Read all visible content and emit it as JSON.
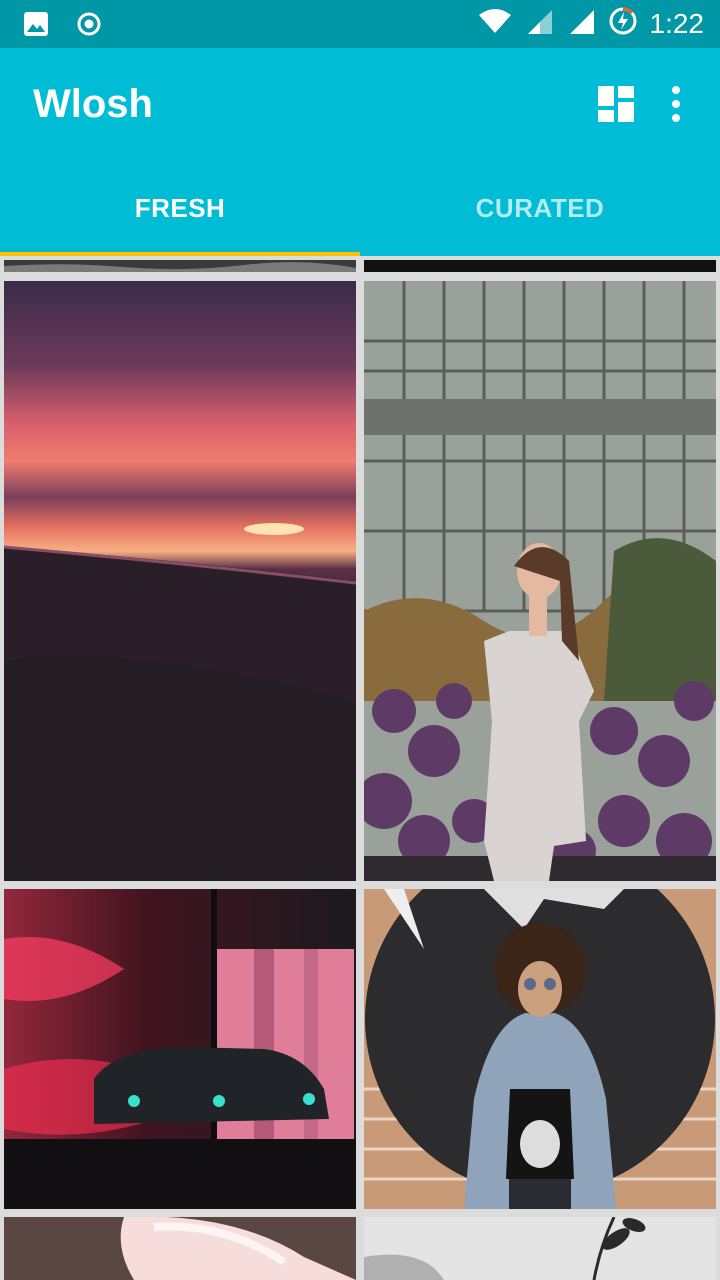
{
  "status_bar": {
    "time": "1:22",
    "left_icons": [
      "image-icon",
      "record-icon"
    ],
    "right_icons": [
      "wifi-icon",
      "cell-signal-icon",
      "cell-signal-icon",
      "battery-charging-icon"
    ]
  },
  "app_bar": {
    "title": "Wlosh",
    "actions": [
      "layout-toggle-icon",
      "more-vert-icon"
    ],
    "background": "#00bcd4",
    "status_background": "#0097a7"
  },
  "tabs": [
    {
      "label": "FRESH",
      "selected": true
    },
    {
      "label": "CURATED",
      "selected": false
    }
  ],
  "indicator_color": "#ffc107",
  "grid": {
    "photos": [
      {
        "subject": "dark-landscape-partial"
      },
      {
        "subject": "dark-partial"
      },
      {
        "subject": "sunset-over-clouds"
      },
      {
        "subject": "woman-in-greenhouse-with-flowers"
      },
      {
        "subject": "car-in-neon-pink-light"
      },
      {
        "subject": "woman-curly-hair-denim-jacket"
      },
      {
        "subject": "pink-flamingo-partial"
      },
      {
        "subject": "plant-partial"
      }
    ]
  }
}
